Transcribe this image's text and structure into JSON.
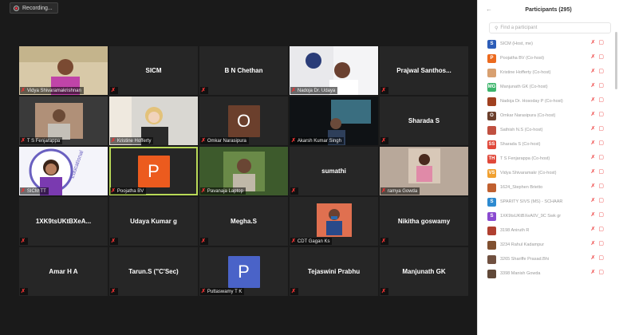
{
  "recording": {
    "label": "Recording..."
  },
  "colors": {
    "stage": "#1a1a1a",
    "tile": "#262626",
    "active_border": "#b8d957",
    "muted": "#e33"
  },
  "tiles": [
    {
      "name": "Vidya Shivaramakrishnan",
      "kind": "photo",
      "photo": "woman-purple"
    },
    {
      "name": "SICM",
      "kind": "big"
    },
    {
      "name": "B N Chethan",
      "kind": "big"
    },
    {
      "name": "Nadoja Dr. Udaya",
      "kind": "photo",
      "photo": "man-office"
    },
    {
      "name": "Prajwal Santhos...",
      "kind": "big"
    },
    {
      "name": "T S Fenjarappa",
      "kind": "photo",
      "photo": "man-seated"
    },
    {
      "name": "Kristine Hofferty",
      "kind": "photo",
      "photo": "woman-blonde"
    },
    {
      "name": "Omkar Narasipura",
      "kind": "avatar",
      "letter": "O",
      "color": "#6b3f2c"
    },
    {
      "name": "Akarsh Kumar Singh",
      "kind": "photo",
      "photo": "man-dark"
    },
    {
      "name": "Sharada S",
      "kind": "big"
    },
    {
      "name": "SICM TT",
      "kind": "photo",
      "photo": "woman-trust"
    },
    {
      "name": "Poojatha BV",
      "kind": "avatar",
      "letter": "P",
      "color": "#ec5b1e"
    },
    {
      "name": "Pavanaja Laptop",
      "kind": "photo",
      "photo": "man-plants"
    },
    {
      "name": "sumathi",
      "kind": "big"
    },
    {
      "name": "ramya Gowda",
      "kind": "photo",
      "photo": "woman-pink"
    },
    {
      "name": "1XK9tsUKtBXeA...",
      "kind": "big"
    },
    {
      "name": "Udaya Kumar g",
      "kind": "big"
    },
    {
      "name": "Megha.S",
      "kind": "big"
    },
    {
      "name": "CDT Gagan Ks",
      "kind": "photo",
      "photo": "man-mask"
    },
    {
      "name": "Nikitha goswamy",
      "kind": "big"
    },
    {
      "name": "Amar H A",
      "kind": "big"
    },
    {
      "name": "Tarun.S (\"C'Sec)",
      "kind": "big"
    },
    {
      "name": "Puttaswamy T K",
      "kind": "avatar",
      "letter": "P",
      "color": "#4a63c8"
    },
    {
      "name": "Tejaswini Prabhu",
      "kind": "big"
    },
    {
      "name": "Manjunath GK",
      "kind": "big"
    }
  ],
  "panel": {
    "title": "Participants (295)",
    "search_placeholder": "Find a participant",
    "participants": [
      {
        "initials": "S",
        "color": "#2d5db8",
        "name": "SICM (Host, me)"
      },
      {
        "initials": "P",
        "color": "#ec6a1e",
        "name": "Poojatha BV (Co-host)"
      },
      {
        "initials": "",
        "color": "#d8a070",
        "name": "Kristine Hofferty (Co-host)"
      },
      {
        "initials": "MG",
        "color": "#3cb56b",
        "name": "Manjunath GK (Co-host)"
      },
      {
        "initials": "",
        "color": "#a04020",
        "name": "Nadoja Dr. Hosoday P (Co-host)"
      },
      {
        "initials": "O",
        "color": "#6b3f2c",
        "name": "Omkar Narasipura (Co-host)"
      },
      {
        "initials": "",
        "color": "#c05040",
        "name": "Sathish N.S (Co-host)"
      },
      {
        "initials": "SS",
        "color": "#e0483a",
        "name": "Sharada S (Co-host)"
      },
      {
        "initials": "TH",
        "color": "#e0483a",
        "name": "T S Fenjarappa (Co-host)"
      },
      {
        "initials": "VS",
        "color": "#f0a030",
        "name": "Vidya Shivaramakr (Co-host)"
      },
      {
        "initials": "",
        "color": "#c06030",
        "name": "1624_Stephen Brietto"
      },
      {
        "initials": "S",
        "color": "#2d8ad0",
        "name": "SPARITY SIVS (MS) - SCHAAR"
      },
      {
        "initials": "S",
        "color": "#8a4ad0",
        "name": "1XK9tsUKtBXeA0V_9C Swk gr"
      },
      {
        "initials": "",
        "color": "#b04030",
        "name": "3198 Aniruth R"
      },
      {
        "initials": "",
        "color": "#805030",
        "name": "3234 Rahul Kadampur"
      },
      {
        "initials": "",
        "color": "#705040",
        "name": "3265 Shariffe Prasad.Bhi"
      },
      {
        "initials": "",
        "color": "#604838",
        "name": "3398 Manish Gowda"
      }
    ]
  }
}
